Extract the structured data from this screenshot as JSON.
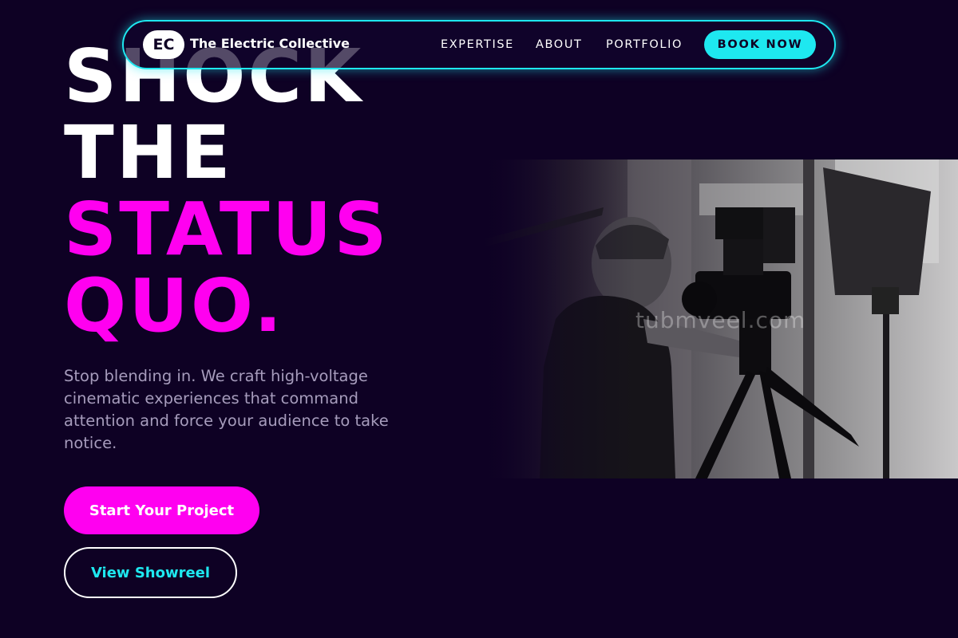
{
  "navbar": {
    "logo_text": "EC",
    "brand_name": "The Electric Collective",
    "links": [
      {
        "label": "EXPERTISE"
      },
      {
        "label": "ABOUT"
      },
      {
        "label": "PORTFOLIO"
      }
    ],
    "cta_label": "BOOK NOW"
  },
  "hero": {
    "headline_lines": [
      "SHOCK",
      "THE",
      "STATUS",
      "QUO."
    ],
    "subtext": "Stop blending in. We craft high-voltage cinematic experiences that command attention and force your audience to take notice.",
    "primary_button": "Start Your Project",
    "secondary_button": "View Showreel",
    "photo_watermark": "tubmveel.com"
  },
  "colors": {
    "background": "#0e0124",
    "accent_magenta": "#ff00f0",
    "accent_cyan": "#1ee8f0",
    "body_text": "#a69cbc"
  }
}
